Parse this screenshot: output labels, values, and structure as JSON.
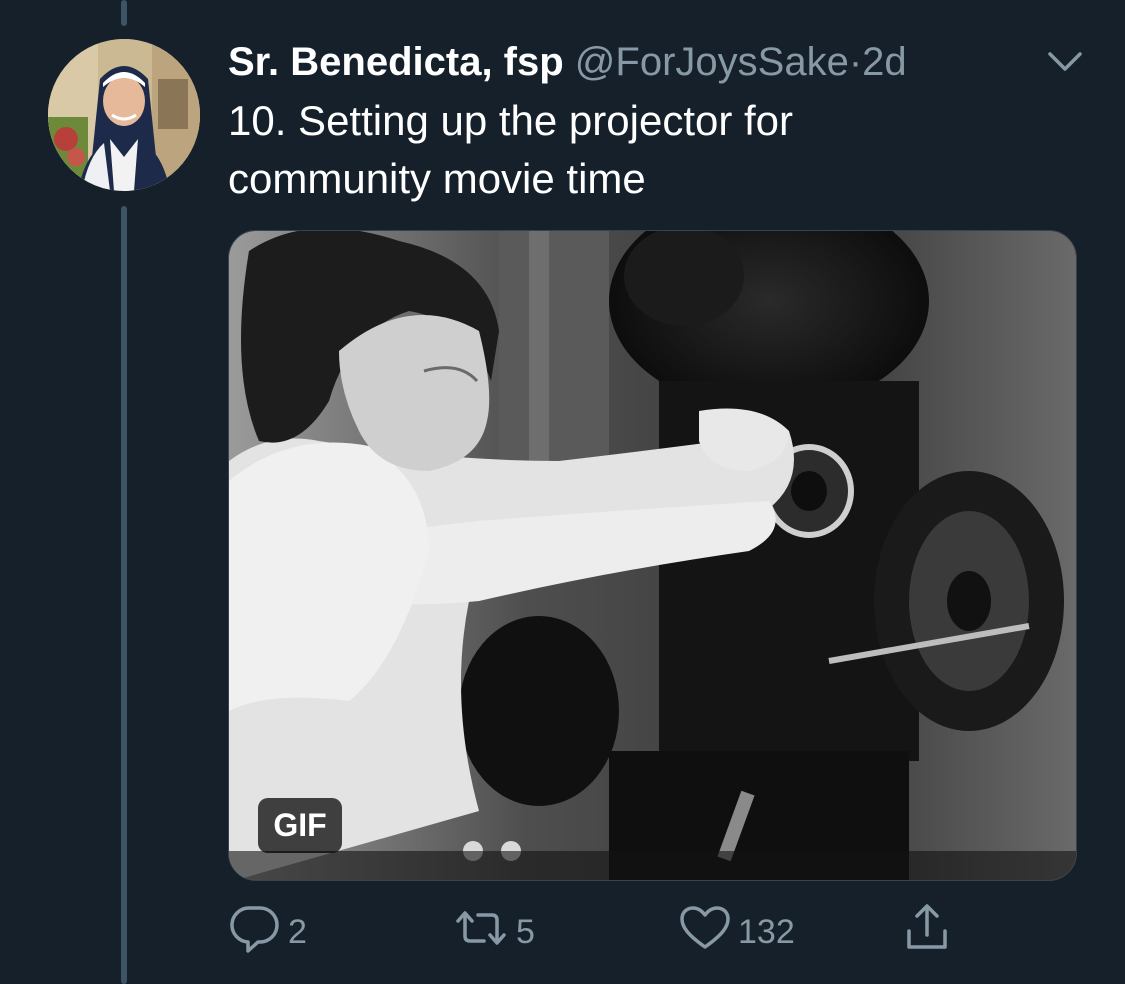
{
  "tweet": {
    "display_name": "Sr. Benedicta, fsp",
    "handle": "@ForJoysSake",
    "separator": "·",
    "time": "2d",
    "text": "10. Setting up the projector for\ncommunity movie time",
    "media": {
      "badge": "GIF"
    },
    "actions": {
      "reply_count": "2",
      "retweet_count": "5",
      "like_count": "132"
    }
  },
  "icons": {
    "more": "chevron-down-icon",
    "reply": "reply-icon",
    "retweet": "retweet-icon",
    "like": "heart-icon",
    "share": "share-icon"
  },
  "colors": {
    "background": "#15202b",
    "secondary_text": "#8899a6",
    "thread_line": "#3d5466"
  }
}
